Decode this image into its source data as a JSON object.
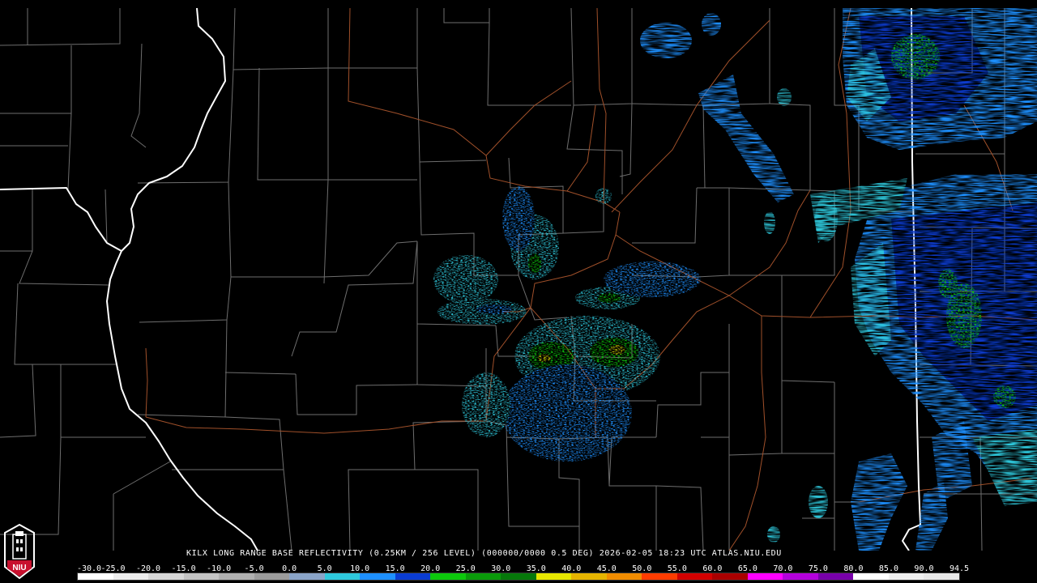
{
  "caption": "KILX LONG RANGE BASE REFLECTIVITY (0.25KM / 256 LEVEL) (000000/0000 0.5 DEG) 2026-02-05 18:23 UTC  ATLAS.NIU.EDU",
  "logo": {
    "text": "NIU",
    "icon": "niu-seal-icon",
    "colors": {
      "frame": "#ffffff",
      "badge": "#c8102e"
    }
  },
  "color_scale": {
    "labels": [
      "-30.0",
      "-25.0",
      "-20.0",
      "-15.0",
      "-10.0",
      "-5.0",
      "0.0",
      "5.0",
      "10.0",
      "15.0",
      "20.0",
      "25.0",
      "30.0",
      "35.0",
      "40.0",
      "45.0",
      "50.0",
      "55.0",
      "60.0",
      "65.0",
      "70.0",
      "75.0",
      "80.0",
      "85.0",
      "90.0",
      "94.5"
    ],
    "colors": [
      "#ffffff",
      "#ececec",
      "#d8d8d8",
      "#c4c4c4",
      "#b0b0b0",
      "#9c9c9c",
      "#8aa4c8",
      "#2ec8dc",
      "#1e90ff",
      "#0a3cd2",
      "#0cc80c",
      "#0a9a0a",
      "#06780a",
      "#e6e600",
      "#e6b400",
      "#f08c00",
      "#ff3c00",
      "#d20000",
      "#aa0000",
      "#ff00ff",
      "#b400dc",
      "#7800aa",
      "#ffffff",
      "#f0f0f0",
      "#e8e8e8"
    ]
  },
  "map_colors": {
    "background": "#000000",
    "county_lines": "#707070",
    "state_lines": "#ffffff",
    "highways": "#a0502a"
  },
  "radar_colors": {
    "cyan": "#2ec8dc",
    "light_blue": "#1e90ff",
    "blue": "#0a3cd2",
    "green": "#0cc80c",
    "dark_green": "#0a9a0a",
    "yellow": "#e6e600"
  },
  "radar_site": "KILX"
}
